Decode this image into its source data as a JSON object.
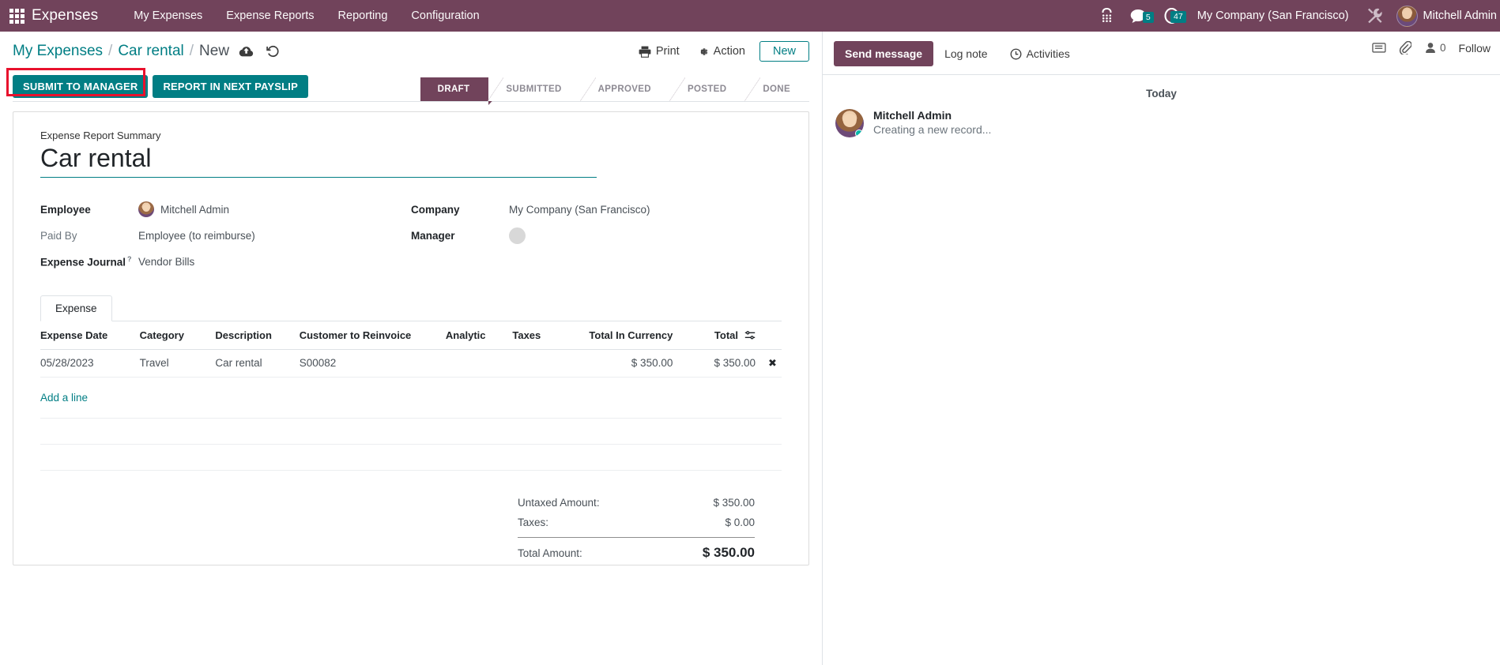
{
  "navbar": {
    "apps_icon": "apps-grid-icon",
    "brand": "Expenses",
    "menu": [
      {
        "label": "My Expenses"
      },
      {
        "label": "Expense Reports"
      },
      {
        "label": "Reporting"
      },
      {
        "label": "Configuration"
      }
    ],
    "voip_icon": "dialpad-icon",
    "messages_icon": "chat-bubble-icon",
    "messages_count": "5",
    "activities_icon": "clock-icon",
    "activities_count": "47",
    "company": "My Company (San Francisco)",
    "debug_icon": "wrench-icon",
    "user_name": "Mitchell Admin",
    "badge_color": "#017e84",
    "bg_color": "#71435b"
  },
  "control_panel": {
    "breadcrumb": {
      "root": "My Expenses",
      "sep": "/",
      "parent": "Car rental",
      "current": "New"
    },
    "save_icon": "cloud-upload-icon",
    "discard_icon": "undo-icon",
    "print_label": "Print",
    "print_icon": "printer-icon",
    "action_label": "Action",
    "action_icon": "gear-icon",
    "new_label": "New"
  },
  "action_buttons": [
    {
      "label": "Submit to Manager",
      "highlighted": true
    },
    {
      "label": "Report in Next Payslip",
      "highlighted": false
    }
  ],
  "statusbar": {
    "stages": [
      "Draft",
      "Submitted",
      "Approved",
      "Posted",
      "Done"
    ],
    "active": "Draft",
    "active_color": "#71435b"
  },
  "annotation": {
    "color": "#e8112d",
    "target": "submit-to-manager-button"
  },
  "form": {
    "summary_label": "Expense Report Summary",
    "title": "Car rental",
    "left_fields": [
      {
        "label": "Employee",
        "value": "Mitchell Admin",
        "bold": true,
        "avatar": true
      },
      {
        "label": "Paid By",
        "value": "Employee (to reimburse)",
        "bold": false,
        "avatar": false
      },
      {
        "label": "Expense Journal",
        "value": "Vendor Bills",
        "bold": true,
        "avatar": false,
        "help": "?"
      }
    ],
    "right_fields": [
      {
        "label": "Company",
        "value": "My Company (San Francisco)",
        "bold": true,
        "avatar": false
      },
      {
        "label": "Manager",
        "value": "",
        "bold": true,
        "avatar": true
      }
    ]
  },
  "notebook": {
    "tabs": [
      {
        "label": "Expense",
        "active": true
      }
    ],
    "columns": [
      "Expense Date",
      "Category",
      "Description",
      "Customer to Reinvoice",
      "Analytic",
      "Taxes",
      "Total In Currency",
      "Total"
    ],
    "rows": [
      {
        "expense_date": "05/28/2023",
        "category": "Travel",
        "description": "Car rental",
        "customer_to_reinvoice": "S00082",
        "analytic": "",
        "taxes": "",
        "total_in_currency": "$ 350.00",
        "total": "$ 350.00",
        "delete_icon": "close-x-icon"
      }
    ],
    "add_line_label": "Add a line",
    "column_toggle_icon": "column-options-icon"
  },
  "totals": [
    {
      "label": "Untaxed Amount:",
      "value": "$ 350.00",
      "emphasis": false
    },
    {
      "label": "Taxes:",
      "value": "$ 0.00",
      "emphasis": false
    },
    {
      "label": "Total Amount:",
      "value": "$ 350.00",
      "emphasis": true
    }
  ],
  "chatter": {
    "send_message_label": "Send message",
    "log_note_label": "Log note",
    "activities_label": "Activities",
    "activities_icon": "clock-plus-icon",
    "attachments_icon": "paperclip-icon",
    "print_preview_icon": "document-icon",
    "followers_icon": "user-icon",
    "followers_count": "0",
    "follow_label": "Follow",
    "date_divider": "Today",
    "messages": [
      {
        "author": "Mitchell Admin",
        "body": "Creating a new record...",
        "online": true
      }
    ]
  }
}
